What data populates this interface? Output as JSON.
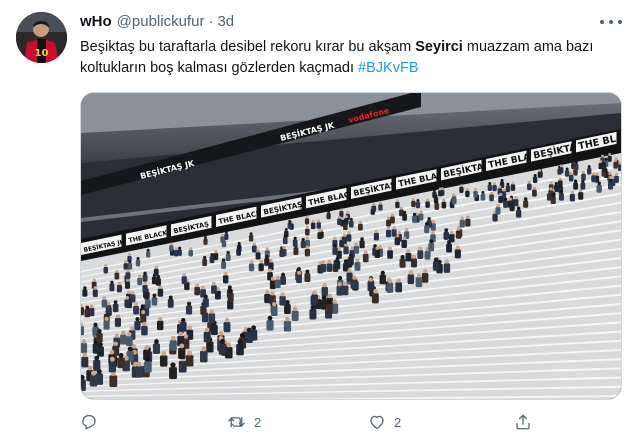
{
  "tweet": {
    "display_name": "wHo",
    "handle": "@publickufur",
    "separator": "·",
    "time": "3d",
    "text_part1": "Beşiktaş bu taraftarla desibel rekoru kırar bu akşam ",
    "text_bold": "Seyirci",
    "text_part2": " muazzam ama bazı koltukların boş kalması gözlerden kaçmadı ",
    "hashtag": "#BJKvFB",
    "jersey_number": "10"
  },
  "media": {
    "banner_texts": [
      "BEŞİKTAŞ JK",
      "THE BLACK EAGLES"
    ],
    "sponsor_text": "vodafone"
  },
  "actions": {
    "reply_icon": "reply-icon",
    "retweet_icon": "retweet-icon",
    "retweet_count": "2",
    "like_icon": "heart-icon",
    "like_count": "2",
    "share_icon": "share-icon"
  },
  "colors": {
    "text": "#0f1419",
    "secondary": "#536471",
    "accent": "#1d9bf0",
    "border": "#cfd9de"
  }
}
